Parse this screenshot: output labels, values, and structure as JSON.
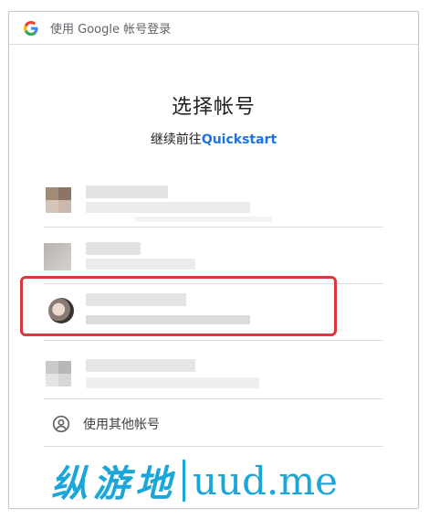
{
  "header": {
    "text": "使用 Google 帐号登录",
    "icon": "google-logo-icon"
  },
  "title": "选择帐号",
  "subtitle": {
    "prefix": "继续前往",
    "app_name": "Quickstart"
  },
  "accounts": [
    {
      "name": "",
      "email": "",
      "blurred": true
    },
    {
      "name": "",
      "email": "",
      "blurred": true
    },
    {
      "name": "",
      "email": "",
      "blurred": true,
      "highlighted": true
    },
    {
      "name": "",
      "email": "",
      "blurred": true
    }
  ],
  "use_other": {
    "label": "使用其他帐号",
    "icon": "person-circle-icon"
  },
  "watermark": {
    "cn": "纵游地",
    "en": "uud.me"
  },
  "colors": {
    "link": "#1a73e8",
    "highlight": "#d8383e",
    "watermark": "#1aa6d8",
    "divider": "#dadce0"
  }
}
